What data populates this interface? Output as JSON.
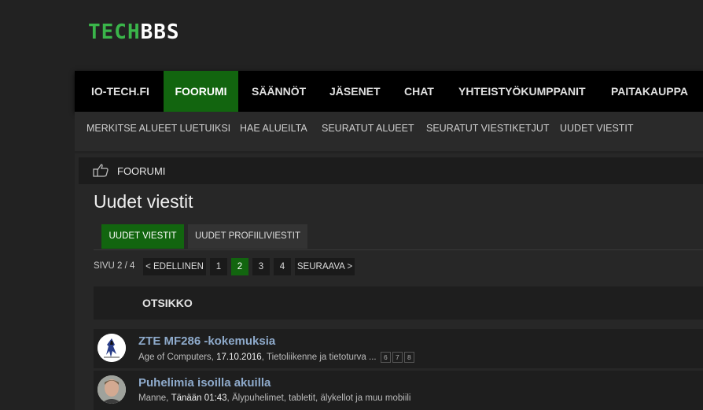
{
  "logo": {
    "part1": "TECH",
    "part2": "BBS"
  },
  "nav": {
    "items": [
      "IO-TECH.FI",
      "FOORUMI",
      "SÄÄNNÖT",
      "JÄSENET",
      "CHAT",
      "YHTEISTYÖKUMPPANIT",
      "PAITAKAUPPA"
    ],
    "active": "FOORUMI"
  },
  "subnav": {
    "items": [
      "MERKITSE ALUEET LUETUIKSI",
      "HAE ALUEILTA",
      "SEURATUT ALUEET",
      "SEURATUT VIESTIKETJUT",
      "UUDET VIESTIT"
    ]
  },
  "breadcrumb": {
    "label": "FOORUMI"
  },
  "page": {
    "title": "Uudet viestit"
  },
  "tabs": {
    "items": [
      "UUDET VIESTIT",
      "UUDET PROFIILIVIESTIT"
    ],
    "active": "UUDET VIESTIT"
  },
  "pager": {
    "label": "SIVU 2 / 4",
    "prev": "< EDELLINEN",
    "pages": [
      "1",
      "2",
      "3",
      "4"
    ],
    "current": "2",
    "next": "SEURAAVA >"
  },
  "table": {
    "header": "OTSIKKO"
  },
  "threads": [
    {
      "title": "ZTE MF286 -kokemuksia",
      "author": "Age of Computers",
      "date": "17.10.2016",
      "forum": "Tietoliikenne ja tietoturva",
      "ellipsis": "...",
      "pages": [
        "6",
        "7",
        "8"
      ]
    },
    {
      "title": "Puhelimia isoilla akuilla",
      "author": "Manne",
      "date": "Tänään 01:43",
      "forum": "Älypuhelimet, tabletit, älykellot ja muu mobiili",
      "ellipsis": "",
      "pages": []
    }
  ],
  "colors": {
    "accent": "#12650f",
    "logo_green": "#3ab54a",
    "link": "#8eaacb"
  }
}
